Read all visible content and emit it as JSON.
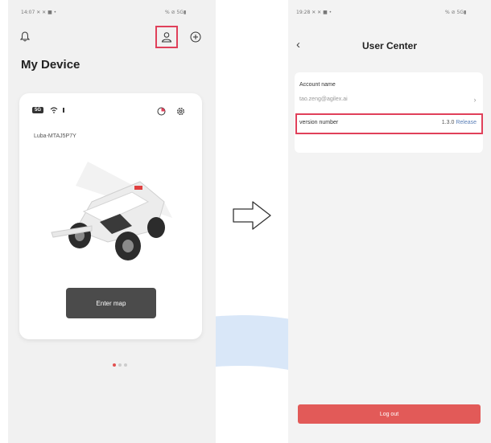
{
  "colors": {
    "accent": "#e0405a",
    "watermark": "#1f6fd6",
    "logout_bg": "#e25a58",
    "dark_button": "#4b4b4b"
  },
  "left_screen": {
    "status_bar": "14:07 ✕ ✕ ■ •",
    "status_right": "% ⊘ 5G▮",
    "icons": {
      "bell": "bell-icon",
      "user": "user-icon",
      "add": "plus-circle-icon"
    },
    "title": "My Device",
    "card": {
      "device_badge": "5G",
      "device_name": "Luba-MTAJ5P7Y",
      "enter_button": "Enter map"
    },
    "pager": {
      "count": 3,
      "active": 0
    }
  },
  "right_screen": {
    "status_bar": "19:28 ✕ ✕ ■ •",
    "status_right": "% ⊘ 5G▮",
    "title": "User Center",
    "account_label": "Account name",
    "account_value": "tao.zeng@agilex.ai",
    "version_label": "version number",
    "version_value": "1.3.0",
    "version_tag": "Release",
    "logout": "Log out"
  }
}
